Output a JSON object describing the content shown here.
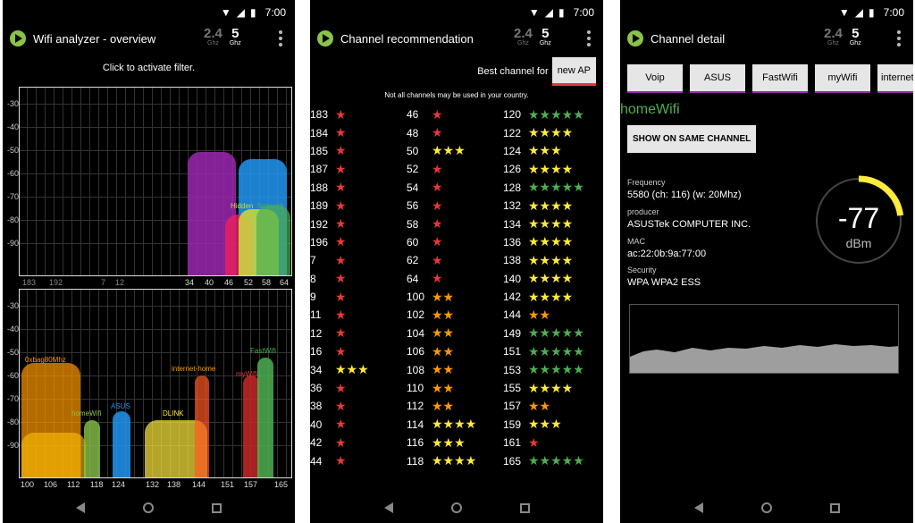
{
  "status": {
    "time": "7:00"
  },
  "band": {
    "b24": "2.4",
    "b24_unit": "Ghz",
    "b5": "5",
    "b5_unit": "Ghz"
  },
  "overview": {
    "title": "Wifi analyzer - overview",
    "filter_hint": "Click to activate filter.",
    "y_labels": [
      "-30",
      "-40",
      "-50",
      "-60",
      "-70",
      "-80",
      "-90"
    ],
    "x_top": [
      "183",
      "192",
      "7",
      "12",
      "34",
      "40",
      "46",
      "52",
      "58",
      "64"
    ],
    "x_bottom": [
      "100",
      "106",
      "112",
      "118",
      "124",
      "132",
      "138",
      "144",
      "151",
      "157",
      "165"
    ],
    "networks_top": [
      "Hidden",
      "Network"
    ],
    "networks_bottom": [
      "0xbag80Mhz",
      "homeWifi",
      "ASUS",
      "DLINK",
      "internet-home",
      "myWifi",
      "FastWifi"
    ]
  },
  "recommendation": {
    "title": "Channel recommendation",
    "best_label": "Best channel for",
    "new_ap_button": "new AP",
    "note": "Not all channels may be used in your country.",
    "channels": [
      [
        [
          "183",
          1
        ],
        [
          "184",
          1
        ],
        [
          "185",
          1
        ],
        [
          "187",
          1
        ],
        [
          "188",
          1
        ],
        [
          "189",
          1
        ],
        [
          "192",
          1
        ],
        [
          "196",
          1
        ],
        [
          "7",
          1
        ],
        [
          "8",
          1
        ],
        [
          "9",
          1
        ],
        [
          "11",
          1
        ],
        [
          "12",
          1
        ],
        [
          "16",
          1
        ],
        [
          "34",
          3
        ],
        [
          "36",
          1
        ],
        [
          "38",
          1
        ],
        [
          "40",
          1
        ],
        [
          "42",
          1
        ],
        [
          "44",
          1
        ]
      ],
      [
        [
          "46",
          1
        ],
        [
          "48",
          1
        ],
        [
          "50",
          3
        ],
        [
          "52",
          1
        ],
        [
          "54",
          1
        ],
        [
          "56",
          1
        ],
        [
          "58",
          1
        ],
        [
          "60",
          1
        ],
        [
          "62",
          1
        ],
        [
          "64",
          1
        ],
        [
          "100",
          2
        ],
        [
          "102",
          2
        ],
        [
          "104",
          2
        ],
        [
          "106",
          2
        ],
        [
          "108",
          2
        ],
        [
          "110",
          2
        ],
        [
          "112",
          2
        ],
        [
          "114",
          4
        ],
        [
          "116",
          3
        ],
        [
          "118",
          4
        ]
      ],
      [
        [
          "120",
          5
        ],
        [
          "122",
          4
        ],
        [
          "124",
          3
        ],
        [
          "126",
          4
        ],
        [
          "128",
          5
        ],
        [
          "132",
          4
        ],
        [
          "134",
          4
        ],
        [
          "136",
          4
        ],
        [
          "138",
          4
        ],
        [
          "140",
          4
        ],
        [
          "142",
          4
        ],
        [
          "144",
          2
        ],
        [
          "149",
          5
        ],
        [
          "151",
          5
        ],
        [
          "153",
          5
        ],
        [
          "155",
          4
        ],
        [
          "157",
          2
        ],
        [
          "159",
          3
        ],
        [
          "161",
          1
        ],
        [
          "165",
          5
        ]
      ]
    ]
  },
  "detail": {
    "title": "Channel detail",
    "tabs": [
      "Voip",
      "ASUS",
      "FastWifi",
      "myWifi",
      "internet-home"
    ],
    "ssid": "homeWifi",
    "show_button": "SHOW ON SAME CHANNEL",
    "frequency_label": "Frequency",
    "frequency": "5580 (ch: 116) (w: 20Mhz)",
    "producer_label": "producer",
    "producer": "ASUSTek COMPUTER INC.",
    "mac_label": "MAC",
    "mac": "ac:22:0b:9a:77:00",
    "security_label": "Security",
    "security": "WPA WPA2 ESS",
    "signal": "-77",
    "signal_unit": "dBm",
    "signal_fraction": 0.23
  },
  "colors": {
    "star1": "#e53935",
    "star2": "#ff9800",
    "star3": "#ffeb3b",
    "star4": "#ffeb3b",
    "star5": "#4caf50",
    "accent": "#8bc34a"
  }
}
